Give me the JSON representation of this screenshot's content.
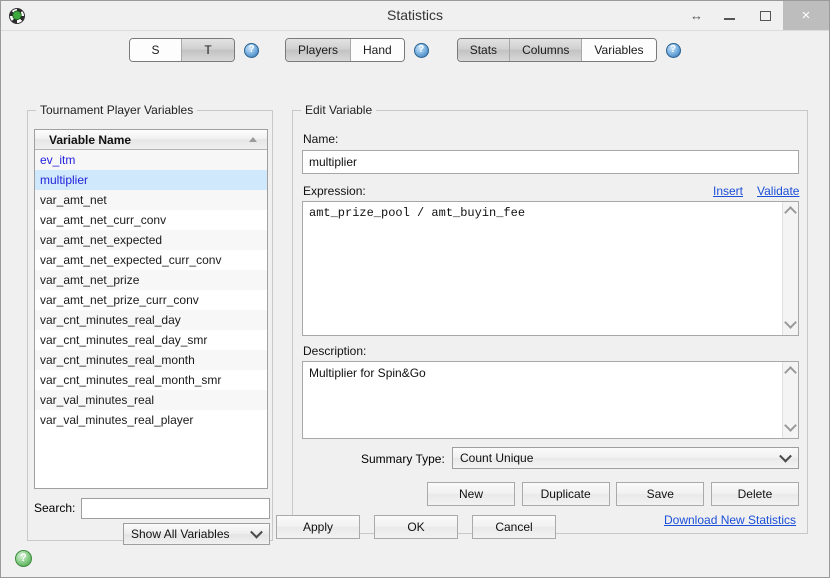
{
  "window": {
    "title": "Statistics",
    "app_icon": "app-logo-icon",
    "buttons": {
      "resize": "↔",
      "minimize": "minimize-icon",
      "maximize": "maximize-icon",
      "close": "×"
    }
  },
  "toolbar": {
    "group_scope": {
      "items": [
        {
          "label": "S",
          "active": true
        },
        {
          "label": "T",
          "active": false
        }
      ],
      "help": "?"
    },
    "group_level": {
      "items": [
        {
          "label": "Players",
          "active": false
        },
        {
          "label": "Hand",
          "active": true
        }
      ],
      "help": "?"
    },
    "group_view": {
      "items": [
        {
          "label": "Stats",
          "active": false
        },
        {
          "label": "Columns",
          "active": false
        },
        {
          "label": "Variables",
          "active": true
        }
      ],
      "help": "?"
    }
  },
  "left_panel": {
    "title": "Tournament Player Variables",
    "column_header": "Variable Name",
    "sort": "ascending",
    "rows": [
      {
        "name": "ev_itm",
        "custom": true,
        "selected": false
      },
      {
        "name": "multiplier",
        "custom": true,
        "selected": true
      },
      {
        "name": "var_amt_net",
        "custom": false,
        "selected": false
      },
      {
        "name": "var_amt_net_curr_conv",
        "custom": false,
        "selected": false
      },
      {
        "name": "var_amt_net_expected",
        "custom": false,
        "selected": false
      },
      {
        "name": "var_amt_net_expected_curr_conv",
        "custom": false,
        "selected": false
      },
      {
        "name": "var_amt_net_prize",
        "custom": false,
        "selected": false
      },
      {
        "name": "var_amt_net_prize_curr_conv",
        "custom": false,
        "selected": false
      },
      {
        "name": "var_cnt_minutes_real_day",
        "custom": false,
        "selected": false
      },
      {
        "name": "var_cnt_minutes_real_day_smr",
        "custom": false,
        "selected": false
      },
      {
        "name": "var_cnt_minutes_real_month",
        "custom": false,
        "selected": false
      },
      {
        "name": "var_cnt_minutes_real_month_smr",
        "custom": false,
        "selected": false
      },
      {
        "name": "var_val_minutes_real",
        "custom": false,
        "selected": false
      },
      {
        "name": "var_val_minutes_real_player",
        "custom": false,
        "selected": false
      }
    ],
    "search_label": "Search:",
    "search_value": "",
    "search_placeholder": "",
    "filter_selected": "Show All Variables"
  },
  "right_panel": {
    "title": "Edit Variable",
    "name_label": "Name:",
    "name_value": "multiplier",
    "expression_label": "Expression:",
    "expression_value": "amt_prize_pool / amt_buyin_fee",
    "insert_link": "Insert",
    "validate_link": "Validate",
    "description_label": "Description:",
    "description_value": "Multiplier for Spin&Go",
    "summary_type_label": "Summary Type:",
    "summary_type_value": "Count Unique",
    "actions": [
      {
        "label": "New"
      },
      {
        "label": "Duplicate"
      },
      {
        "label": "Save"
      },
      {
        "label": "Delete"
      }
    ],
    "download_link": "Download New Statistics"
  },
  "footer": {
    "buttons": [
      {
        "label": "Apply"
      },
      {
        "label": "OK"
      },
      {
        "label": "Cancel"
      }
    ],
    "help": "?"
  },
  "colors": {
    "link": "#1b4fd8",
    "custom_variable": "#2222dd",
    "selection": "#cfe8fb",
    "window_bg": "#f0f0f0"
  }
}
